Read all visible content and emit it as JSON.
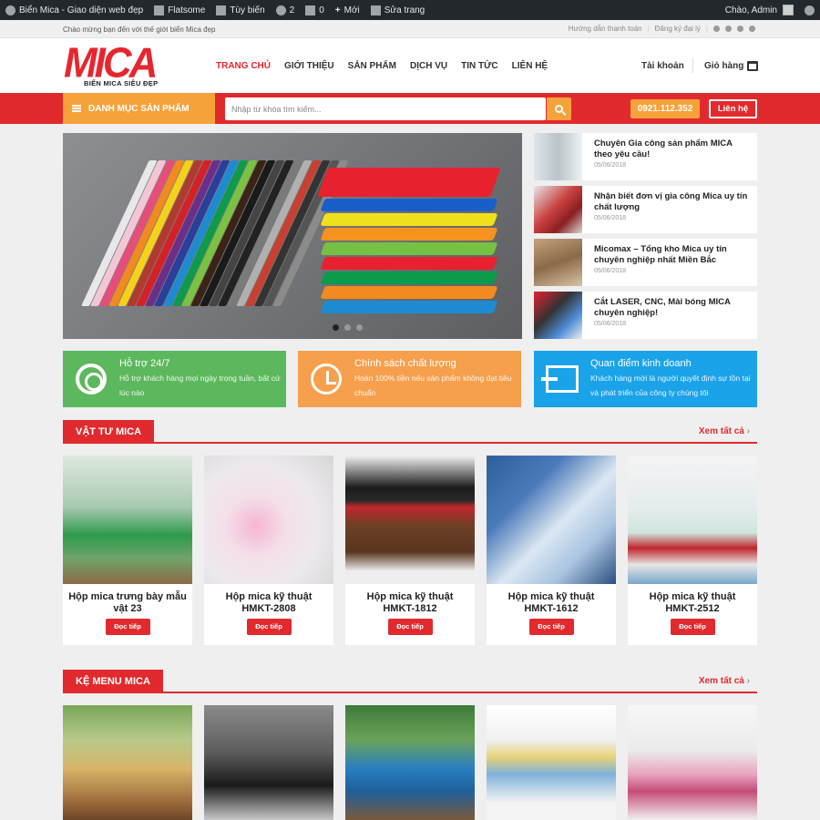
{
  "admin_bar": {
    "site": "Biển Mica - Giao diện web đẹp",
    "theme": "Flatsome",
    "customize": "Tùy biến",
    "updates": "2",
    "comments": "0",
    "new": "Mới",
    "edit": "Sửa trang",
    "greeting": "Chào, Admin"
  },
  "topbar": {
    "welcome": "Chào mừng bạn đến với thế giới biển Mica đẹp",
    "payment": "Hướng dẫn thanh toán",
    "agent": "Đăng ký đại lý"
  },
  "header": {
    "logo": "MICA",
    "tagline": "BIỂN MICA SIÊU ĐẸP",
    "nav": [
      "TRANG CHỦ",
      "GIỚI THIỆU",
      "SẢN PHẨM",
      "DỊCH VỤ",
      "TIN TỨC",
      "LIÊN HỆ"
    ],
    "account": "Tài khoản",
    "cart": "Giỏ hàng"
  },
  "searchbar": {
    "category_menu": "DANH MỤC SẢN PHẨM",
    "placeholder": "Nhập từ khóa tìm kiếm...",
    "phone": "0921.112.352",
    "contact": "Liên hệ"
  },
  "news": [
    {
      "title": "Chuyên Gia công sản phẩm MICA theo yêu cầu!",
      "date": "05/06/2018"
    },
    {
      "title": "Nhận biết đơn vị gia công Mica uy tín chất lượng",
      "date": "05/06/2018"
    },
    {
      "title": "Micomax – Tổng kho Mica uy tín chuyên nghiệp nhất Miền Bắc",
      "date": "05/06/2018"
    },
    {
      "title": "Cắt LASER, CNC, Mài bóng MICA chuyên nghiệp!",
      "date": "05/06/2018"
    }
  ],
  "features": [
    {
      "title": "Hỗ trợ 24/7",
      "desc": "Hỗ trợ khách hàng mọi ngày trong tuần, bất cứ lúc nào",
      "color": "#5cb85c"
    },
    {
      "title": "Chính sách chất lượng",
      "desc": "Hoàn 100% tiền nếu sản phẩm không đạt tiêu chuẩn",
      "color": "#f6a04d"
    },
    {
      "title": "Quan điểm kinh doanh",
      "desc": "Khách hàng mới là người quyết định sự tồn tại và phát triển của công ty chúng tôi",
      "color": "#1aa3e8"
    }
  ],
  "section1": {
    "title": "VẬT TƯ MICA",
    "more": "Xem tất cả",
    "products": [
      {
        "name": "Hộp mica trưng bày mẫu vật 23",
        "button": "Đọc tiếp"
      },
      {
        "name": "Hộp mica kỹ thuật HMKT-2808",
        "button": "Đọc tiếp"
      },
      {
        "name": "Hộp mica kỹ thuật HMKT-1812",
        "button": "Đọc tiếp"
      },
      {
        "name": "Hộp mica kỹ thuật HMKT-1612",
        "button": "Đọc tiếp"
      },
      {
        "name": "Hộp mica kỹ thuật HMKT-2512",
        "button": "Đọc tiếp"
      }
    ]
  },
  "section2": {
    "title": "KỆ MENU MICA",
    "more": "Xem tất cả"
  },
  "colors": {
    "brand_red": "#e12a2d",
    "accent_orange": "#f6a23a"
  }
}
